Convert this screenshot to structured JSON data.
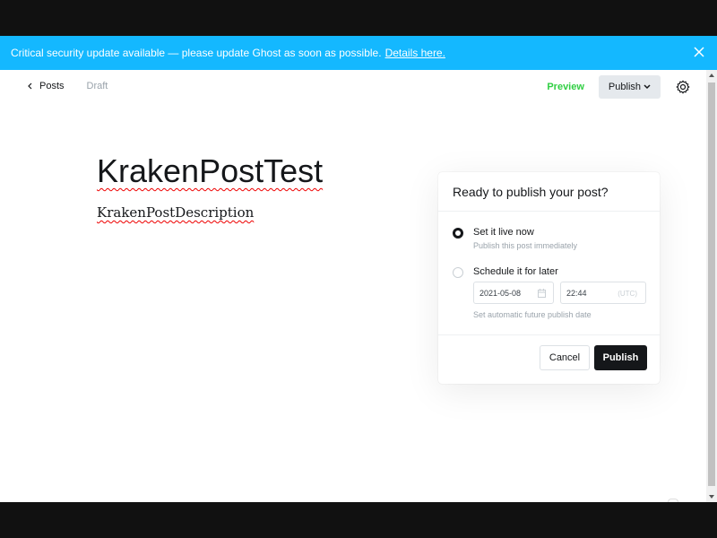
{
  "banner": {
    "message": "Critical security update available — please update Ghost as soon as possible.",
    "link": "Details here.",
    "close_icon": "close-icon"
  },
  "nav": {
    "back_label": "Posts",
    "status": "Draft",
    "preview": "Preview",
    "publish": "Publish",
    "settings_icon": "gear-icon"
  },
  "post": {
    "title": "KrakenPostTest",
    "description": "KrakenPostDescription"
  },
  "publish_menu": {
    "heading": "Ready to publish your post?",
    "option_now": {
      "title": "Set it live now",
      "subtitle": "Publish this post immediately",
      "selected": true
    },
    "option_later": {
      "title": "Schedule it for later",
      "date": "2021-05-08",
      "time": "22:44",
      "timezone": "(UTC)",
      "note": "Set automatic future publish date",
      "selected": false
    },
    "cancel": "Cancel",
    "publish": "Publish"
  },
  "colors": {
    "banner": "#14b8ff",
    "preview": "#30cf43",
    "primary_button": "#15171a"
  }
}
